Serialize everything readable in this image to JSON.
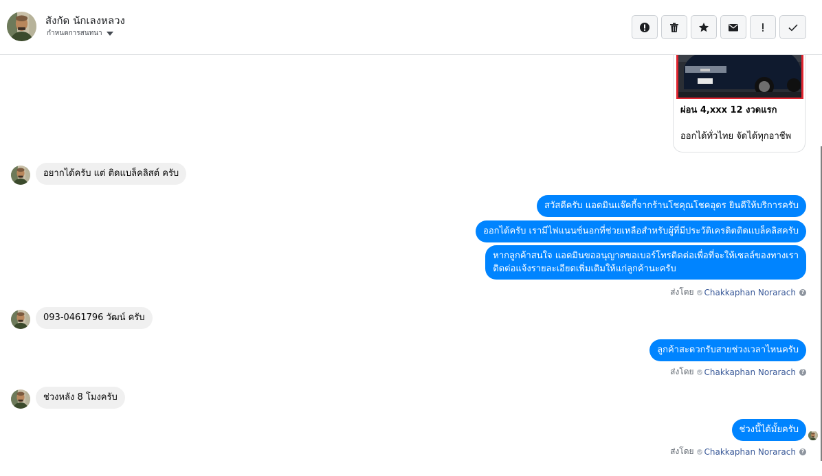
{
  "header": {
    "contact_name": "สังกัด นักเลงหลวง",
    "subtitle": "กำหนดการสนทนา",
    "actions": [
      {
        "icon": "alert-circle-icon",
        "label": "Mark as spam"
      },
      {
        "icon": "trash-icon",
        "label": "Delete"
      },
      {
        "icon": "star-icon",
        "label": "Star"
      },
      {
        "icon": "envelope-icon",
        "label": "Mark unread"
      },
      {
        "icon": "exclamation-icon",
        "label": "Follow up"
      },
      {
        "icon": "checkmark-icon",
        "label": "Mark done"
      }
    ]
  },
  "card": {
    "title": "ผ่อน 4,xxx 12 งวดแรก",
    "description": "ออกได้ทั่วไทย จัดได้ทุกอาชีพ"
  },
  "messages": [
    {
      "direction": "in",
      "text": "อยากได้ครับ แต่ ติดแบล็คลิสต์ ครับ"
    },
    {
      "direction": "out",
      "text": "สวัสดีครับ แอดมินแจ๊คกี้จากร้านโชคุณโชคอุดร ยินดีให้บริการครับ"
    },
    {
      "direction": "out",
      "text": "ออกได้ครับ เรามีไฟแนนซ์นอกที่ช่วยเหลือสำหรับผู้ที่มีประวัติเครดิตติดแบล็คลิสครับ"
    },
    {
      "direction": "out",
      "line1": "หากลูกค้าสนใจ แอดมินขออนุญาตขอเบอร์โทรติดต่อเพื่อที่จะให้เซลล์ของทางเรา",
      "line2": "ติดต่อแจ้งรายละเอียดเพิ่มเติมให้แก่ลูกค้านะครับ"
    },
    {
      "direction": "in",
      "text": "093-0461796 วัฒน์ ครับ"
    },
    {
      "direction": "out",
      "text": "ลูกค้าสะดวกรับสายช่วงเวลาไหนครับ"
    },
    {
      "direction": "in",
      "text": "ช่วงหลัง 8 โมงครับ"
    },
    {
      "direction": "out",
      "text": "ช่วงนี้ได้มั้ยครับ"
    }
  ],
  "sent_by": {
    "prefix": "ส่งโดย",
    "sender": "Chakkaphan Norarach",
    "help": "?"
  },
  "colors": {
    "outgoing_bubble": "#0084ff",
    "incoming_bubble": "#f0f0f0",
    "sender_link": "#385898"
  }
}
